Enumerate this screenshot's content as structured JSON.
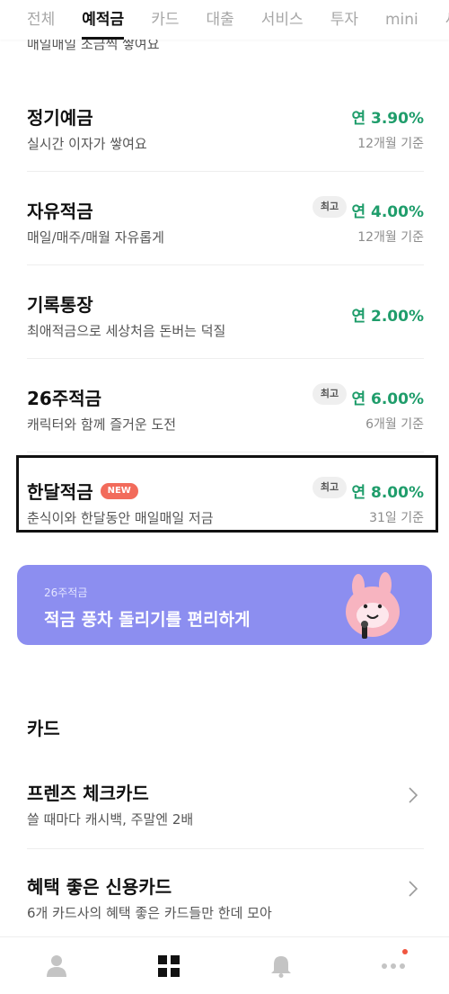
{
  "tabs": [
    {
      "label": "전체",
      "active": false
    },
    {
      "label": "예적금",
      "active": true
    },
    {
      "label": "카드",
      "active": false
    },
    {
      "label": "대출",
      "active": false
    },
    {
      "label": "서비스",
      "active": false
    },
    {
      "label": "투자",
      "active": false
    },
    {
      "label": "mini",
      "active": false
    },
    {
      "label": "세",
      "active": false
    }
  ],
  "prev_item_subtitle": "매일매일 조금씩 쌓여요",
  "savings": [
    {
      "title": "정기예금",
      "subtitle": "실시간 이자가 쌓여요",
      "rate": "연 3.90%",
      "basis": "12개월 기준",
      "badge": ""
    },
    {
      "title": "자유적금",
      "subtitle": "매일/매주/매월 자유롭게",
      "rate": "연 4.00%",
      "basis": "12개월 기준",
      "badge": "최고"
    },
    {
      "title": "기록통장",
      "subtitle": "최애적금으로 세상처음 돈버는 덕질",
      "rate": "연 2.00%",
      "basis": "",
      "badge": ""
    },
    {
      "title": "26주적금",
      "subtitle": "캐릭터와 함께 즐거운 도전",
      "rate": "연 6.00%",
      "basis": "6개월 기준",
      "badge": "최고"
    },
    {
      "title": "한달적금",
      "new_badge": "NEW",
      "subtitle": "춘식이와 한달동안 매일매일 저금",
      "rate": "연 8.00%",
      "basis": "31일 기준",
      "badge": "최고"
    }
  ],
  "banner": {
    "small": "26주적금",
    "big": "적금 풍차 돌리기를 편리하게"
  },
  "card_section": {
    "title": "카드",
    "items": [
      {
        "title": "프렌즈 체크카드",
        "subtitle": "쓸 때마다 캐시백, 주말엔 2배"
      },
      {
        "title": "혜택 좋은 신용카드",
        "subtitle": "6개 카드사의 혜택 좋은 카드들만 한데 모아"
      }
    ]
  },
  "bottom_nav": [
    {
      "icon": "person-icon",
      "active": false
    },
    {
      "icon": "grid-icon",
      "active": true
    },
    {
      "icon": "bell-icon",
      "active": false
    },
    {
      "icon": "more-icon",
      "active": false,
      "has_dot": true
    }
  ],
  "colors": {
    "rate_green": "#1f9d6b",
    "new_red": "#f26b5b",
    "banner_purple": "#8c8ef0",
    "notification_dot": "#f0553f"
  }
}
